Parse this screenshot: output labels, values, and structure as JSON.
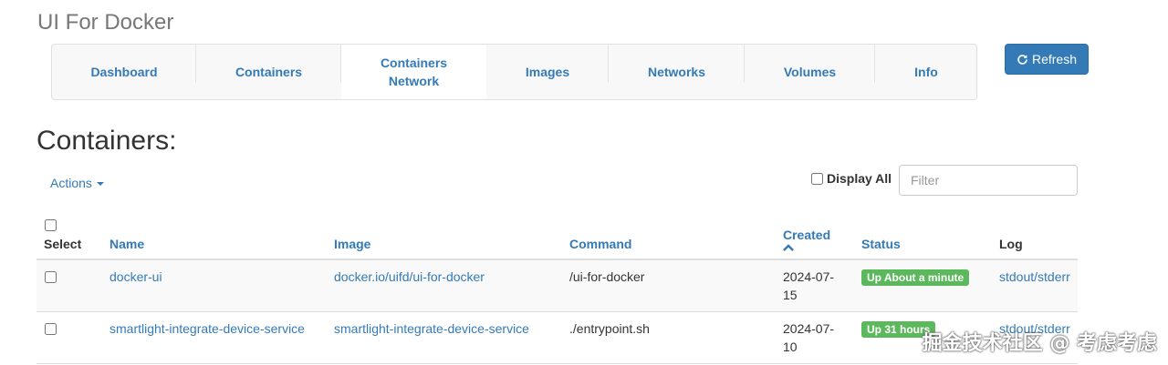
{
  "app": {
    "title": "UI For Docker"
  },
  "nav": {
    "items": [
      {
        "label": "Dashboard"
      },
      {
        "label": "Containers"
      },
      {
        "label": "Containers Network"
      },
      {
        "label": "Images"
      },
      {
        "label": "Networks"
      },
      {
        "label": "Volumes"
      },
      {
        "label": "Info"
      }
    ]
  },
  "toolbar": {
    "refresh_label": "Refresh"
  },
  "page": {
    "title": "Containers:"
  },
  "actions": {
    "label": "Actions"
  },
  "filter": {
    "display_all_label": "Display All",
    "placeholder": "Filter",
    "value": ""
  },
  "table": {
    "headers": {
      "select": "Select",
      "name": "Name",
      "image": "Image",
      "command": "Command",
      "created": "Created",
      "status": "Status",
      "log": "Log"
    },
    "rows": [
      {
        "name": "docker-ui",
        "image": "docker.io/uifd/ui-for-docker",
        "command": "/ui-for-docker",
        "created": "2024-07-15",
        "status": "Up About a minute",
        "log": "stdout/stderr"
      },
      {
        "name": "smartlight-integrate-device-service",
        "image": "smartlight-integrate-device-service",
        "command": "./entrypoint.sh",
        "created": "2024-07-10",
        "status": "Up 31 hours",
        "log": "stdout/stderr"
      }
    ]
  },
  "watermark": {
    "text": "掘金技术社区 @ 考虑考虑"
  },
  "colors": {
    "accent": "#337ab7",
    "status_up": "#5cb85c"
  }
}
